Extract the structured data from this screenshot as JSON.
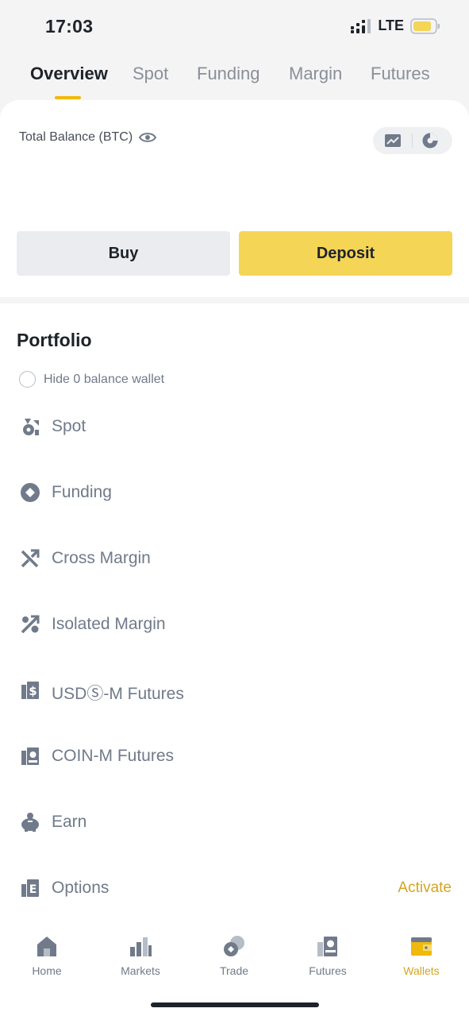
{
  "status_bar": {
    "time": "17:03",
    "network": "LTE"
  },
  "tabs": [
    {
      "label": "Overview",
      "active": true
    },
    {
      "label": "Spot"
    },
    {
      "label": "Funding"
    },
    {
      "label": "Margin"
    },
    {
      "label": "Futures"
    }
  ],
  "balance": {
    "label": "Total Balance (BTC)"
  },
  "actions": {
    "buy": "Buy",
    "deposit": "Deposit"
  },
  "portfolio": {
    "title": "Portfolio",
    "hide_zero": "Hide 0 balance wallet",
    "wallets": [
      {
        "label": "Spot",
        "icon": "spot-icon"
      },
      {
        "label": "Funding",
        "icon": "funding-icon"
      },
      {
        "label": "Cross Margin",
        "icon": "cross-margin-icon"
      },
      {
        "label": "Isolated Margin",
        "icon": "isolated-margin-icon"
      },
      {
        "label": "USDⓈ-M Futures",
        "icon": "usds-m-futures-icon"
      },
      {
        "label": "COIN-M Futures",
        "icon": "coin-m-futures-icon"
      },
      {
        "label": "Earn",
        "icon": "piggy-bank-icon"
      },
      {
        "label": "Options",
        "icon": "options-icon",
        "action": "Activate"
      }
    ]
  },
  "bottom_nav": [
    {
      "label": "Home",
      "icon": "home-icon"
    },
    {
      "label": "Markets",
      "icon": "markets-icon"
    },
    {
      "label": "Trade",
      "icon": "trade-icon"
    },
    {
      "label": "Futures",
      "icon": "futures-icon"
    },
    {
      "label": "Wallets",
      "icon": "wallet-icon",
      "active": true
    }
  ],
  "colors": {
    "accent": "#f0b90b",
    "deposit": "#f5d556",
    "muted": "#707a8a",
    "active_nav": "#d6a420"
  }
}
